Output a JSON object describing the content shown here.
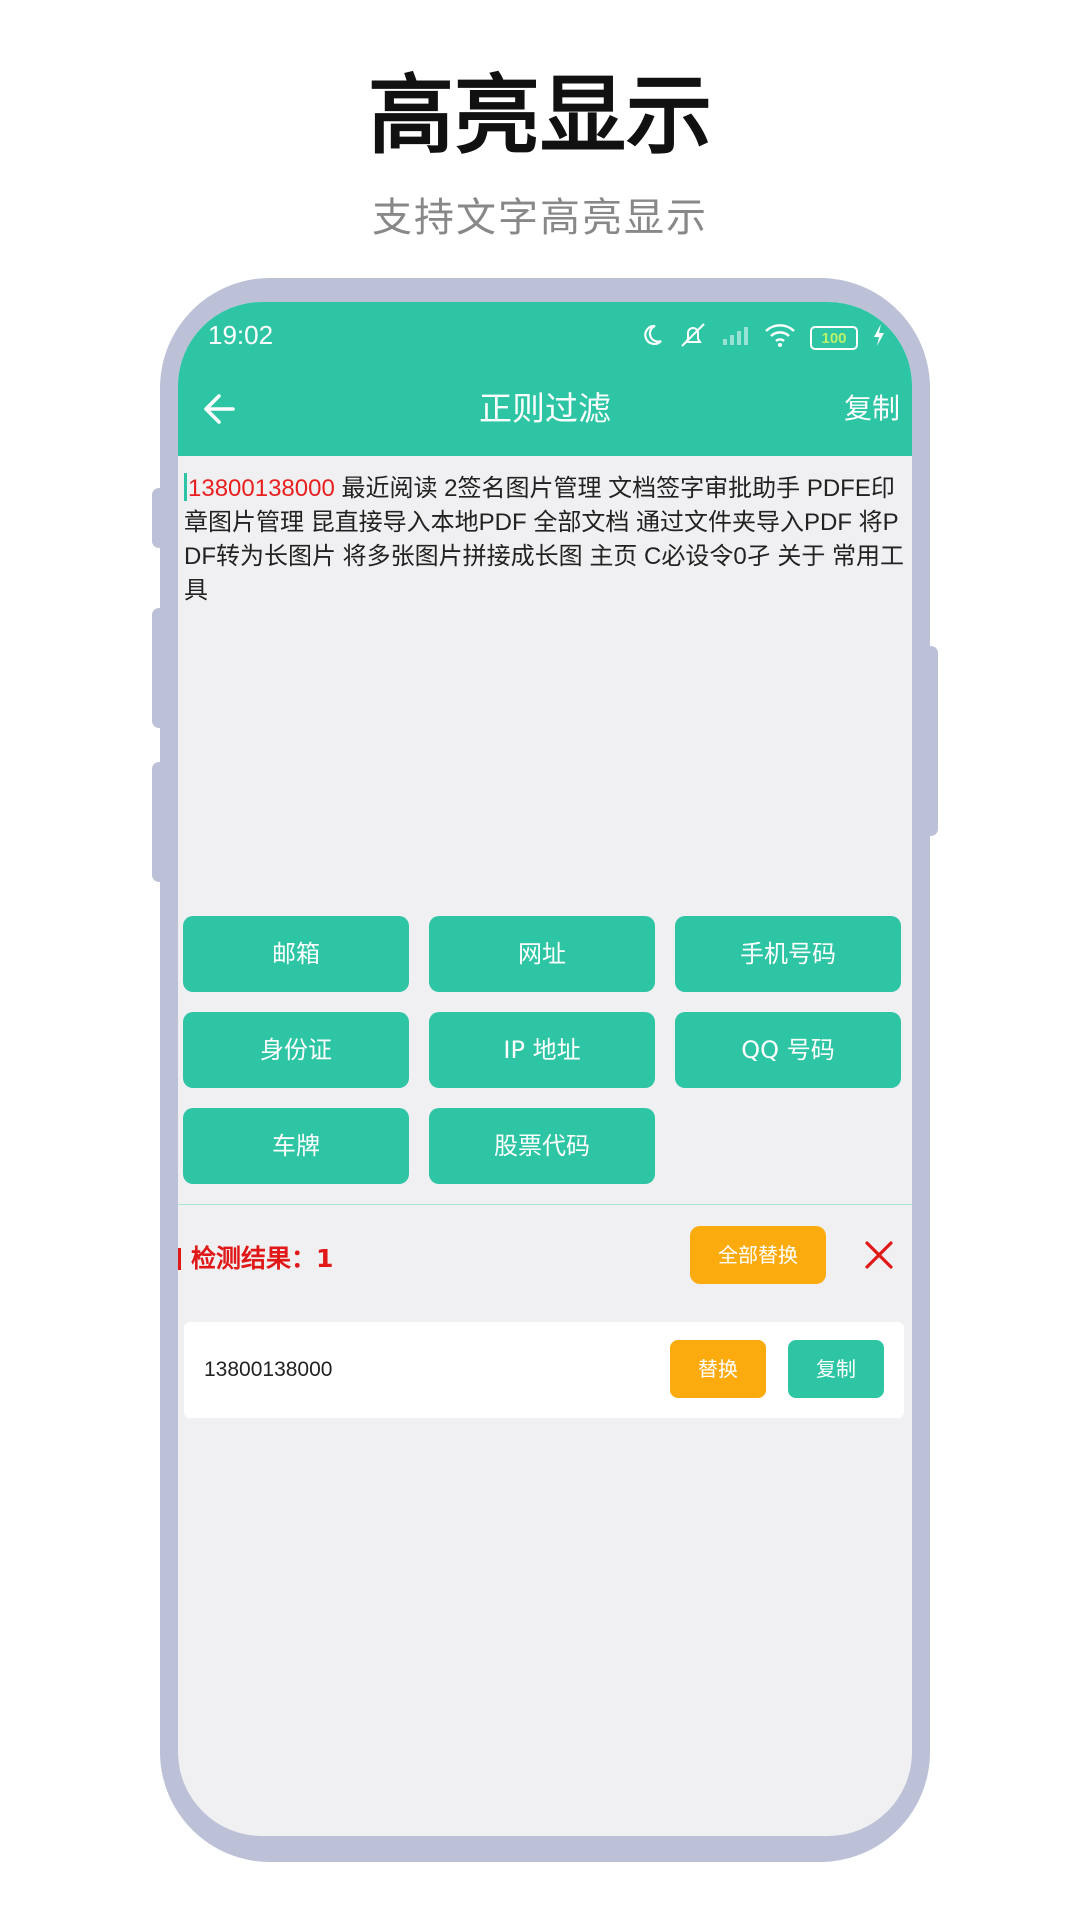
{
  "promo": {
    "title": "高亮显示",
    "subtitle": "支持文字高亮显示"
  },
  "status_bar": {
    "time": "19:02",
    "battery": "100",
    "icons": [
      "moon-icon",
      "alarm-off-icon",
      "signal-icon",
      "wifi-icon",
      "battery-icon",
      "charging-icon"
    ]
  },
  "appbar": {
    "back_icon": "back-arrow-icon",
    "title": "正则过滤",
    "copy_label": "复制"
  },
  "text_content": {
    "highlighted": "13800138000",
    "rest": " 最近阅读 2签名图片管理 文档签字审批助手 PDFE印章图片管理 昆直接导入本地PDF 全部文档 通过文件夹导入PDF 将PDF转为长图片 将多张图片拼接成长图 主页 C必设令0孑 关于 常用工具"
  },
  "filters": [
    {
      "label": "邮箱"
    },
    {
      "label": "网址"
    },
    {
      "label": "手机号码"
    },
    {
      "label": "身份证"
    },
    {
      "label": "IP 地址"
    },
    {
      "label": "QQ 号码"
    },
    {
      "label": "车牌"
    },
    {
      "label": "股票代码"
    }
  ],
  "result": {
    "label": "检测结果：1",
    "replace_all_label": "全部替换",
    "close_icon": "close-icon",
    "items": [
      {
        "value": "13800138000",
        "replace_label": "替换",
        "copy_label": "复制"
      }
    ]
  },
  "colors": {
    "accent": "#2ec5a4",
    "highlight": "#e82020",
    "warning": "#fcab0f",
    "frame": "#bcc1d8"
  }
}
